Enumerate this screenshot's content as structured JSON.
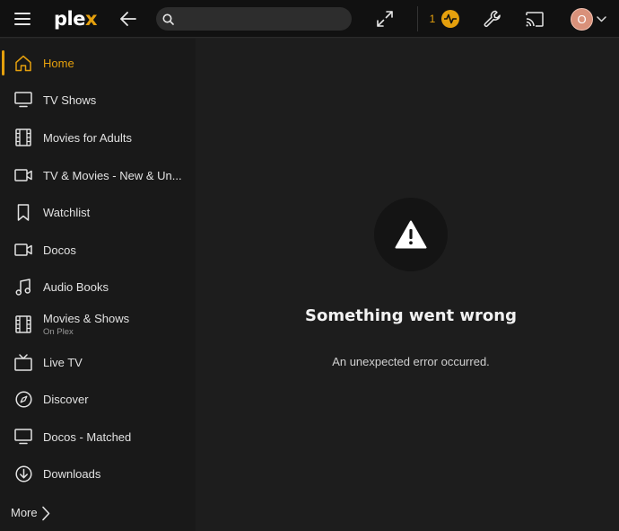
{
  "header": {
    "logo_main": "ple",
    "logo_x": "x",
    "search_placeholder": "",
    "activity_count": "1",
    "avatar_initial": "O",
    "accent_color": "#e5a00d"
  },
  "sidebar": {
    "items": [
      {
        "label": "Home",
        "icon": "home-icon",
        "active": true
      },
      {
        "label": "TV Shows",
        "icon": "monitor-icon"
      },
      {
        "label": "Movies for Adults",
        "icon": "film-icon"
      },
      {
        "label": "TV & Movies - New & Un...",
        "icon": "video-camera-icon"
      },
      {
        "label": "Watchlist",
        "icon": "bookmark-icon"
      },
      {
        "label": "Docos",
        "icon": "video-camera-icon"
      },
      {
        "label": "Audio Books",
        "icon": "music-note-icon"
      },
      {
        "label": "Movies & Shows",
        "sublabel": "On Plex",
        "icon": "film-icon"
      },
      {
        "label": "Live TV",
        "icon": "tv-antenna-icon"
      },
      {
        "label": "Discover",
        "icon": "compass-icon"
      },
      {
        "label": "Docos - Matched",
        "icon": "monitor-icon"
      },
      {
        "label": "Downloads",
        "icon": "download-icon"
      }
    ],
    "more_label": "More"
  },
  "main": {
    "error_title": "Something went wrong",
    "error_message": "An unexpected error occurred."
  }
}
